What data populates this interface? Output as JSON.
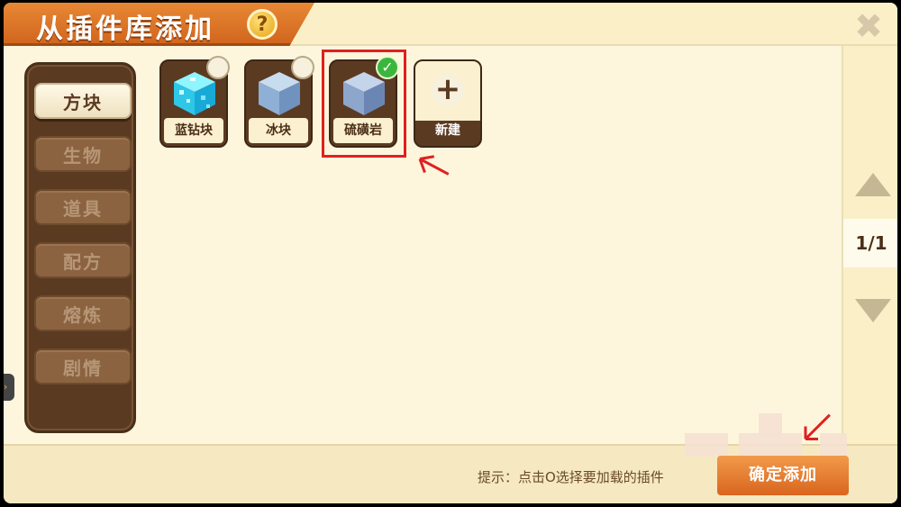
{
  "header": {
    "title": "从插件库添加",
    "help_symbol": "?",
    "close_symbol": "✖"
  },
  "sidebar": {
    "items": [
      {
        "label": "方块",
        "active": true
      },
      {
        "label": "生物",
        "active": false
      },
      {
        "label": "道具",
        "active": false
      },
      {
        "label": "配方",
        "active": false
      },
      {
        "label": "熔炼",
        "active": false
      },
      {
        "label": "剧情",
        "active": false
      }
    ]
  },
  "plugins": [
    {
      "label": "蓝钻块",
      "icon": "diamond-block-icon",
      "selected": false
    },
    {
      "label": "冰块",
      "icon": "ice-block-icon",
      "selected": false
    },
    {
      "label": "硫磺岩",
      "icon": "sulfur-rock-icon",
      "selected": true
    }
  ],
  "new_tile": {
    "label": "新建",
    "symbol": "+"
  },
  "pager": {
    "page": "1/1"
  },
  "footer": {
    "hint": "提示：点击O选择要加载的插件",
    "confirm_label": "确定添加"
  },
  "colors": {
    "accent": "#d9651f",
    "panel": "#5b3a22",
    "highlight": "#e02020",
    "check": "#3bb63d"
  }
}
